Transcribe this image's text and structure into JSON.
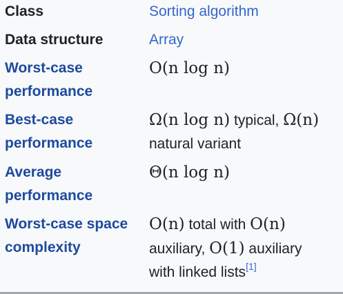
{
  "rows": [
    {
      "label": "Class",
      "value": "Sorting algorithm"
    },
    {
      "label": "Data structure",
      "value": "Array"
    },
    {
      "label_line1": "Worst-case",
      "label_line2": "performance",
      "value_math": "O(n log n)"
    },
    {
      "label_line1": "Best-case",
      "label_line2": "performance",
      "value_math1": "Ω(n log n)",
      "value_text1": " typical, ",
      "value_math2": "Ω(n)",
      "value_text2": "natural variant"
    },
    {
      "label_line1": "Average",
      "label_line2": "performance",
      "value_math": "Θ(n log n)"
    },
    {
      "label_line1": "Worst-case space",
      "label_line2": "complexity",
      "value_math1": "O(n)",
      "value_text1": " total with ",
      "value_math2": "O(n)",
      "value_text2": "auxiliary, ",
      "value_math3": "O(1)",
      "value_text3": " auxiliary",
      "value_text4": "with linked lists",
      "ref": "[1]"
    }
  ],
  "colors": {
    "background": "#f8f9fa",
    "label_link": "#1d4a9e",
    "value_link": "#3366cc",
    "text": "#202122"
  }
}
